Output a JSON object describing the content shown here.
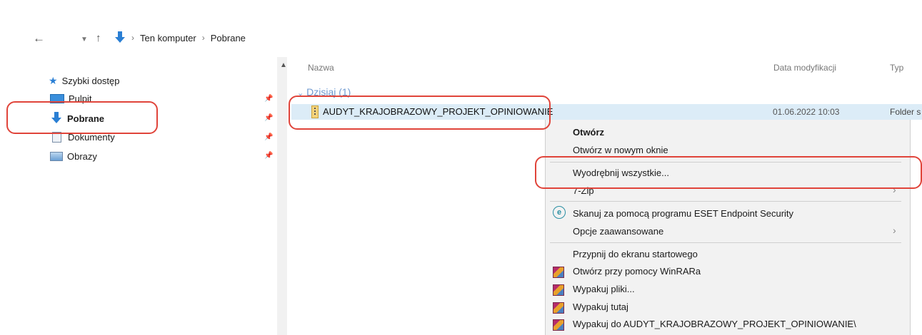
{
  "toolbar": {
    "back_icon": "←",
    "dropdown_icon": "⌄",
    "up_icon": "↑",
    "location_icon": "download-arrow"
  },
  "breadcrumb": {
    "items": [
      "Ten komputer",
      "Pobrane"
    ],
    "separator": "›"
  },
  "sidebar": {
    "items": [
      {
        "label": "Szybki dostęp",
        "icon": "star-icon"
      },
      {
        "label": "Pulpit",
        "icon": "desktop-icon"
      },
      {
        "label": "Pobrane",
        "icon": "download-icon"
      },
      {
        "label": "Dokumenty",
        "icon": "documents-icon"
      },
      {
        "label": "Obrazy",
        "icon": "pictures-icon"
      }
    ]
  },
  "columns": {
    "name": "Nazwa",
    "date": "Data modyfikacji",
    "type": "Typ"
  },
  "group": {
    "label": "Dzisiaj (1)"
  },
  "file": {
    "name": "AUDYT_KRAJOBRAZOWY_PROJEKT_OPINIOWANIE",
    "date": "01.06.2022 10:03",
    "type": "Folder s"
  },
  "context_menu": {
    "open": "Otwórz",
    "open_new_window": "Otwórz w nowym oknie",
    "extract_all": "Wyodrębnij wszystkie...",
    "seven_zip": "7-Zip",
    "eset_scan": "Skanuj za pomocą programu ESET Endpoint Security",
    "advanced": "Opcje zaawansowane",
    "pin_start": "Przypnij do ekranu startowego",
    "winrar_open": "Otwórz przy pomocy WinRARa",
    "extract_files": "Wypakuj pliki...",
    "extract_here": "Wypakuj tutaj",
    "extract_to": "Wypakuj do AUDYT_KRAJOBRAZOWY_PROJEKT_OPINIOWANIE\\"
  },
  "colors": {
    "selection": "#dcecf7",
    "annotation": "#e0443a",
    "group_header": "#6f9ad1"
  }
}
